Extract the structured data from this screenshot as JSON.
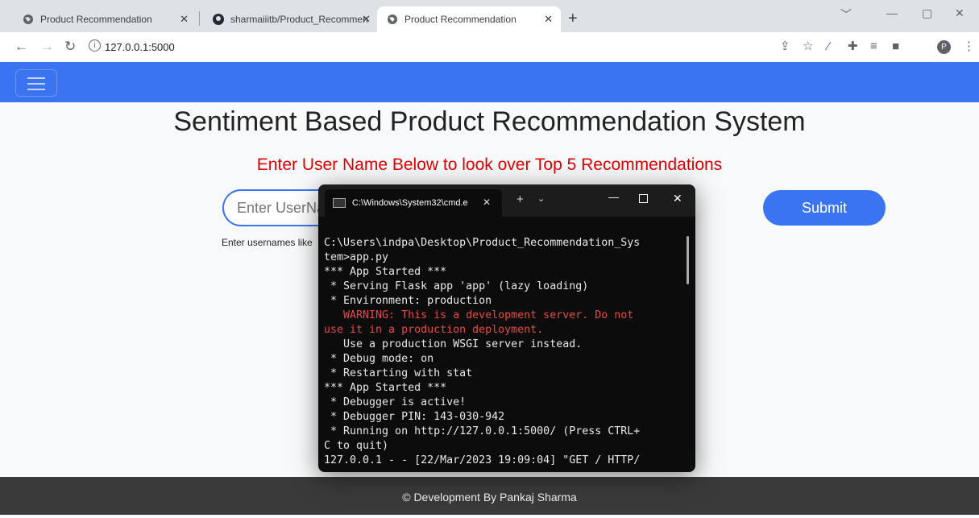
{
  "browser": {
    "tabs": [
      {
        "title": "Product Recommendation",
        "active": false
      },
      {
        "title": "sharmaiiitb/Product_Recommend",
        "active": false
      },
      {
        "title": "Product Recommendation",
        "active": true
      }
    ],
    "url": "127.0.0.1:5000",
    "profile_initial": "P"
  },
  "page": {
    "heading": "Sentiment Based Product Recommendation System",
    "subheading": "Enter User Name Below to look over Top 5 Recommendations",
    "input_placeholder": "Enter UserName",
    "hint": "Enter usernames like",
    "submit_label": "Submit",
    "footer": "© Development By Pankaj Sharma",
    "navbar_color": "#3a74f0"
  },
  "terminal": {
    "title": "C:\\Windows\\System32\\cmd.e",
    "lines": [
      {
        "text": "C:\\Users\\indpa\\Desktop\\Product_Recommendation_Sys",
        "warn": false
      },
      {
        "text": "tem>app.py",
        "warn": false
      },
      {
        "text": "*** App Started ***",
        "warn": false
      },
      {
        "text": " * Serving Flask app 'app' (lazy loading)",
        "warn": false
      },
      {
        "text": " * Environment: production",
        "warn": false
      },
      {
        "text": "   WARNING: This is a development server. Do not",
        "warn": true
      },
      {
        "text": "use it in a production deployment.",
        "warn": true
      },
      {
        "text": "   Use a production WSGI server instead.",
        "warn": false
      },
      {
        "text": " * Debug mode: on",
        "warn": false
      },
      {
        "text": " * Restarting with stat",
        "warn": false
      },
      {
        "text": "*** App Started ***",
        "warn": false
      },
      {
        "text": " * Debugger is active!",
        "warn": false
      },
      {
        "text": " * Debugger PIN: 143-030-942",
        "warn": false
      },
      {
        "text": " * Running on http://127.0.0.1:5000/ (Press CTRL+",
        "warn": false
      },
      {
        "text": "C to quit)",
        "warn": false
      },
      {
        "text": "127.0.0.1 - - [22/Mar/2023 19:09:04] \"GET / HTTP/",
        "warn": false
      }
    ]
  }
}
